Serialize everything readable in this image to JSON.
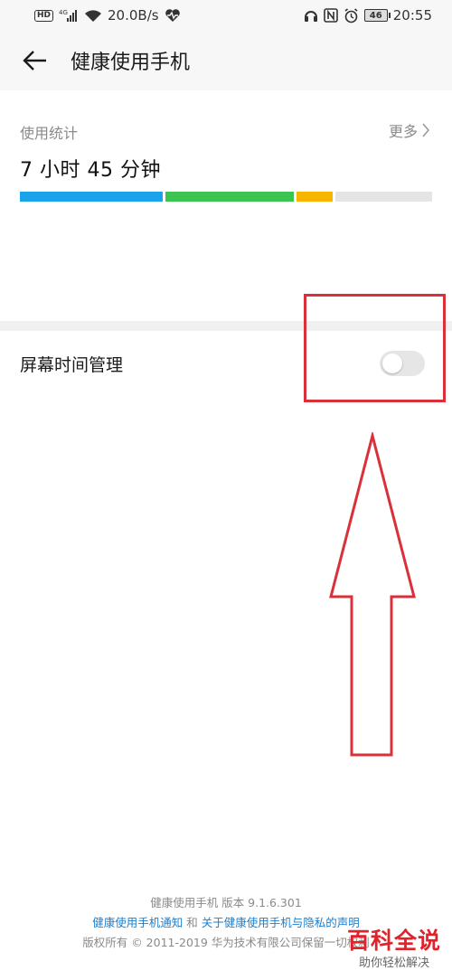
{
  "status_bar": {
    "hd": "HD",
    "network": "4G",
    "speed": "20.0B/s",
    "battery": "46",
    "time": "20:55"
  },
  "app_bar": {
    "title": "健康使用手机"
  },
  "usage": {
    "label": "使用统计",
    "more": "更多",
    "value": "7 小时 45 分钟",
    "segments": [
      {
        "fraction": 0.353,
        "color": "#1aa3e8"
      },
      {
        "fraction": 0.318,
        "color": "#3cc453"
      },
      {
        "fraction": 0.09,
        "color": "#f7b500"
      },
      {
        "fraction": 0.239,
        "color": "#e5e5e5"
      }
    ]
  },
  "setting": {
    "label": "屏幕时间管理",
    "toggle_on": false
  },
  "footer": {
    "version_line": "健康使用手机  版本 9.1.6.301",
    "link1": "健康使用手机通知",
    "and": "和",
    "link2": "关于健康使用手机与隐私的声明",
    "copyright": "版权所有 © 2011-2019 华为技术有限公司保留一切权利"
  },
  "watermark": {
    "title": "百科全说",
    "subtitle": "助你轻松解决"
  },
  "colors": {
    "annotation": "#d9303a",
    "link": "#1a7fd1"
  }
}
